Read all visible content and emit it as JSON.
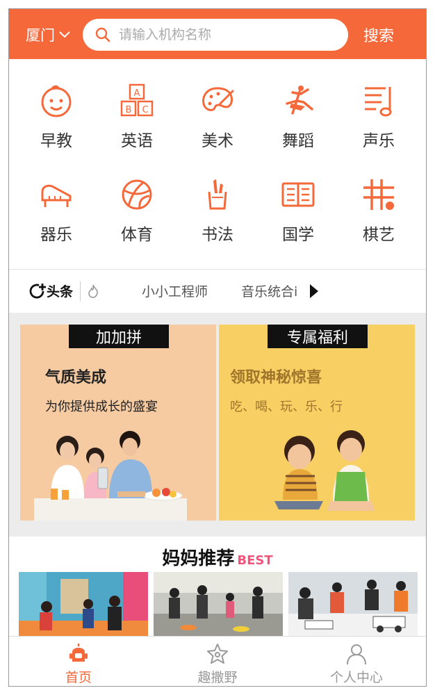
{
  "header": {
    "city": "厦门",
    "search_placeholder": "请输入机构名称",
    "search_button": "搜索"
  },
  "categories": [
    {
      "label": "早教",
      "icon": "baby-face-icon"
    },
    {
      "label": "英语",
      "icon": "abc-blocks-icon"
    },
    {
      "label": "美术",
      "icon": "palette-icon"
    },
    {
      "label": "舞蹈",
      "icon": "dancer-icon"
    },
    {
      "label": "声乐",
      "icon": "music-note-icon"
    },
    {
      "label": "器乐",
      "icon": "piano-icon"
    },
    {
      "label": "体育",
      "icon": "basketball-icon"
    },
    {
      "label": "书法",
      "icon": "brush-pot-icon"
    },
    {
      "label": "国学",
      "icon": "open-book-icon"
    },
    {
      "label": "棋艺",
      "icon": "chess-grid-icon"
    }
  ],
  "news": {
    "logo_text": "头条",
    "items": [
      "小小工程师",
      "音乐统合i"
    ]
  },
  "promos": [
    {
      "tag": "加加拼",
      "title": "气质美成",
      "subtitle": "为你提供成长的盛宴"
    },
    {
      "tag": "专属福利",
      "title": "领取神秘惊喜",
      "subtitle": "吃、喝、玩、乐、行"
    }
  ],
  "recommend": {
    "title": "妈妈推荐",
    "badge": "BEST"
  },
  "tabs": [
    {
      "label": "首页",
      "icon": "robot-home-icon",
      "active": true
    },
    {
      "label": "趣撒野",
      "icon": "star-icon",
      "active": false
    },
    {
      "label": "个人中心",
      "icon": "person-icon",
      "active": false
    }
  ],
  "colors": {
    "accent": "#f4683a",
    "promo_left_bg": "#f7cba2",
    "promo_right_bg": "#f7cf63",
    "best_badge": "#f0567b"
  }
}
